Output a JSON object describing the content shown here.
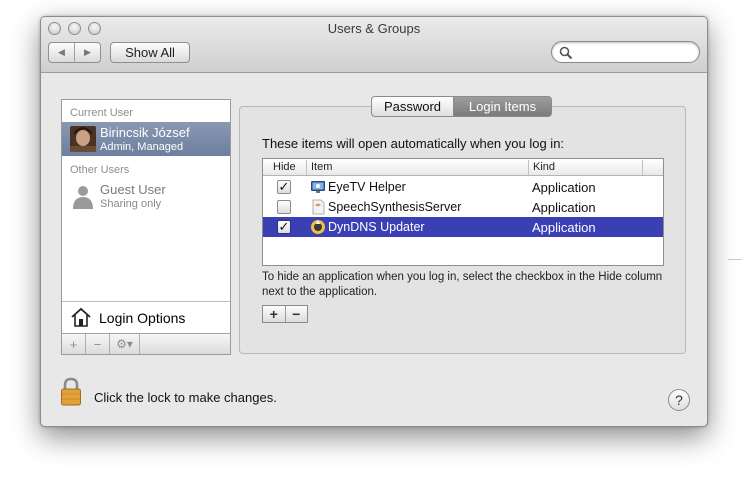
{
  "window": {
    "title": "Users & Groups"
  },
  "toolbar": {
    "back": "◀",
    "forward": "▶",
    "show_all": "Show All",
    "search_value": "",
    "search_placeholder": ""
  },
  "sidebar": {
    "current_user_header": "Current User",
    "current_user": {
      "name": "Birincsik József",
      "role": "Admin, Managed"
    },
    "other_users_header": "Other Users",
    "guest_user": {
      "name": "Guest User",
      "role": "Sharing only"
    },
    "login_options": "Login Options",
    "add": "+",
    "remove": "−",
    "action": "⚙▾"
  },
  "tabs": {
    "password": "Password",
    "login_items": "Login Items",
    "selected": "Login Items"
  },
  "login_items": {
    "intro": "These items will open automatically when you log in:",
    "columns": {
      "hide": "Hide",
      "item": "Item",
      "kind": "Kind"
    },
    "rows": [
      {
        "hide": true,
        "name": "EyeTV Helper",
        "kind": "Application",
        "icon": "eyetv-icon",
        "selected": false
      },
      {
        "hide": false,
        "name": "SpeechSynthesisServer",
        "kind": "Application",
        "icon": "speech-icon",
        "selected": false
      },
      {
        "hide": true,
        "name": "DynDNS Updater",
        "kind": "Application",
        "icon": "dyndns-icon",
        "selected": true
      }
    ],
    "help": "To hide an application when you log in, select the checkbox in the Hide column next to the application.",
    "add": "+",
    "remove": "−"
  },
  "footer": {
    "lock_text": "Click the lock to make changes.",
    "help_button": "?"
  },
  "check_mark": "✓"
}
